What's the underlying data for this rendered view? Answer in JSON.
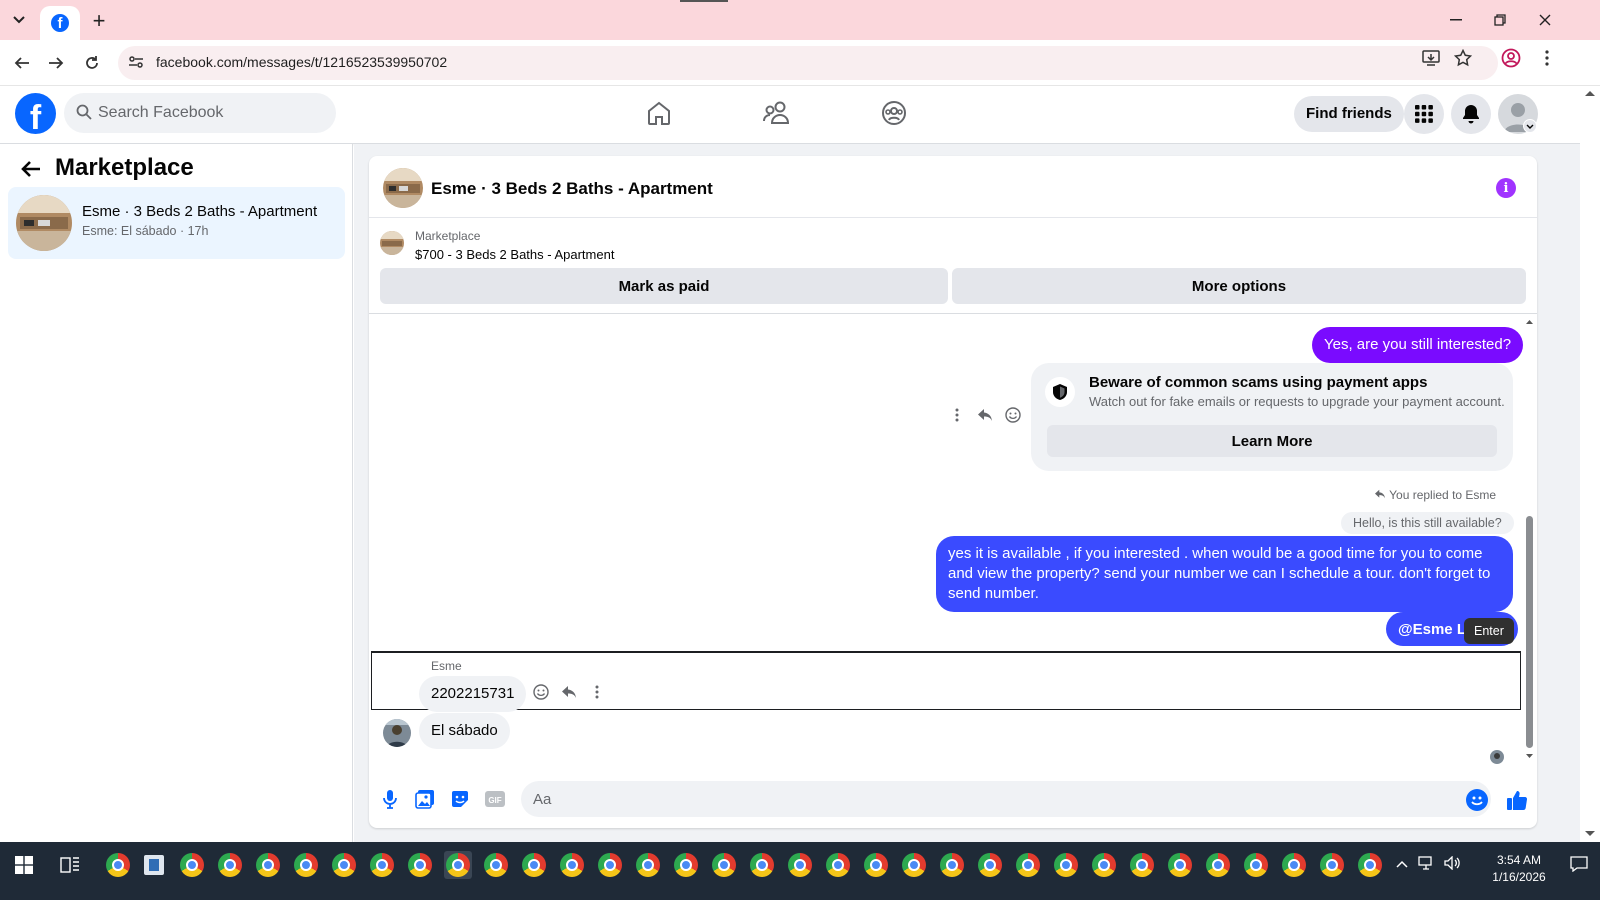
{
  "browser": {
    "url": "facebook.com/messages/t/1216523539950702",
    "new_tab_label": "+"
  },
  "fb": {
    "search_placeholder": "Search Facebook",
    "find_friends": "Find friends",
    "logo_letter": "f"
  },
  "sidebar": {
    "title": "Marketplace",
    "conversation": {
      "title": "Esme · 3 Beds 2 Baths - Apartment",
      "subtitle": "Esme: El sábado · 17h"
    }
  },
  "chat": {
    "title": "Esme · 3 Beds 2 Baths - Apartment",
    "marketplace_label": "Marketplace",
    "listing": "$700 - 3 Beds 2 Baths - Apartment",
    "mark_paid": "Mark as paid",
    "more_options": "More options",
    "messages": {
      "out1": "Yes, are you still interested?",
      "scam_title": "Beware of common scams using payment apps",
      "scam_sub": "Watch out for fake emails or requests to upgrade your payment account.",
      "learn_more": "Learn More",
      "replied_to": "You replied to Esme",
      "quoted": "Hello, is this still available?",
      "out2": "yes it is available , if you interested . when would be  a good time for you to come and view the  property? send your number we can I schedule  a tour. don't forget to send  number.",
      "mention": "@Esme Lil",
      "tooltip": "Enter",
      "sender": "Esme",
      "in1": "2202215731",
      "in2": "El sábado"
    },
    "composer_placeholder": "Aa"
  },
  "taskbar": {
    "time": "3:54 AM",
    "date": "1/16/2026"
  },
  "colors": {
    "fb_blue": "#0866ff",
    "outgoing_purple": "#7a0bff",
    "outgoing_blue": "#3a4bff",
    "tab_bar": "#fbd7dc"
  }
}
